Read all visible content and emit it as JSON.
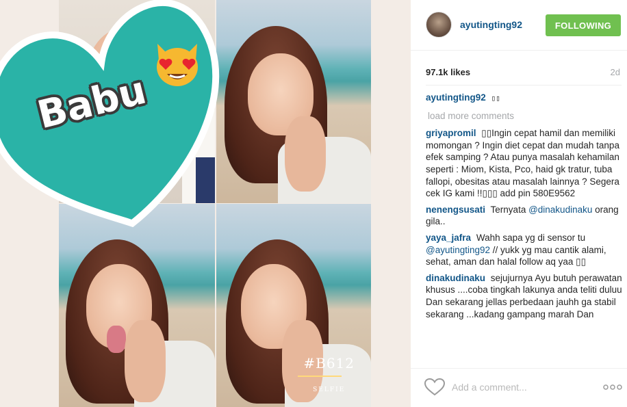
{
  "photo": {
    "sticker_text": "Babu",
    "watermark": "#B612",
    "watermark_sub": "SELFIE"
  },
  "post": {
    "username": "ayutingting92",
    "follow_label": "FOLLOWING",
    "likes": "97.1k likes",
    "age": "2d",
    "caption_text": "▯▯",
    "load_more": "load more comments",
    "add_comment_placeholder": "Add a comment..."
  },
  "comments": [
    {
      "user": "griyapromil",
      "text": "▯▯Ingin cepat hamil dan memiliki momongan ? Ingin diet cepat dan mudah tanpa efek samping ? Atau punya masalah kehamilan seperti : Miom, Kista, Pco, haid gk tratur, tuba fallopi, obesitas atau masalah lainnya ? Segera cek IG kami !!▯▯▯ add pin 580E9562"
    },
    {
      "user": "nenengsusati",
      "text_before": "Ternyata ",
      "mention": "@dinakudinaku",
      "text_after": " orang gila.."
    },
    {
      "user": "yaya_jafra",
      "text_before": "Wahh sapa yg di sensor tu ",
      "mention": "@ayutingting92",
      "text_after": " // yukk yg mau cantik alami, sehat, aman dan halal follow aq yaa ▯▯"
    },
    {
      "user": "dinakudinaku",
      "text": "sejujurnya Ayu butuh perawatan khusus ....coba tingkah lakunya anda teliti duluu Dan sekarang jellas perbedaan jauhh ga stabil sekarang ...kadang gampang marah Dan"
    }
  ],
  "colors": {
    "follow_green": "#70c050",
    "username_blue": "#125688",
    "heart_teal": "#2ab3a7"
  },
  "icons": [
    "heart-outline-icon",
    "more-options-icon",
    "heart-eyes-cat-emoji"
  ]
}
